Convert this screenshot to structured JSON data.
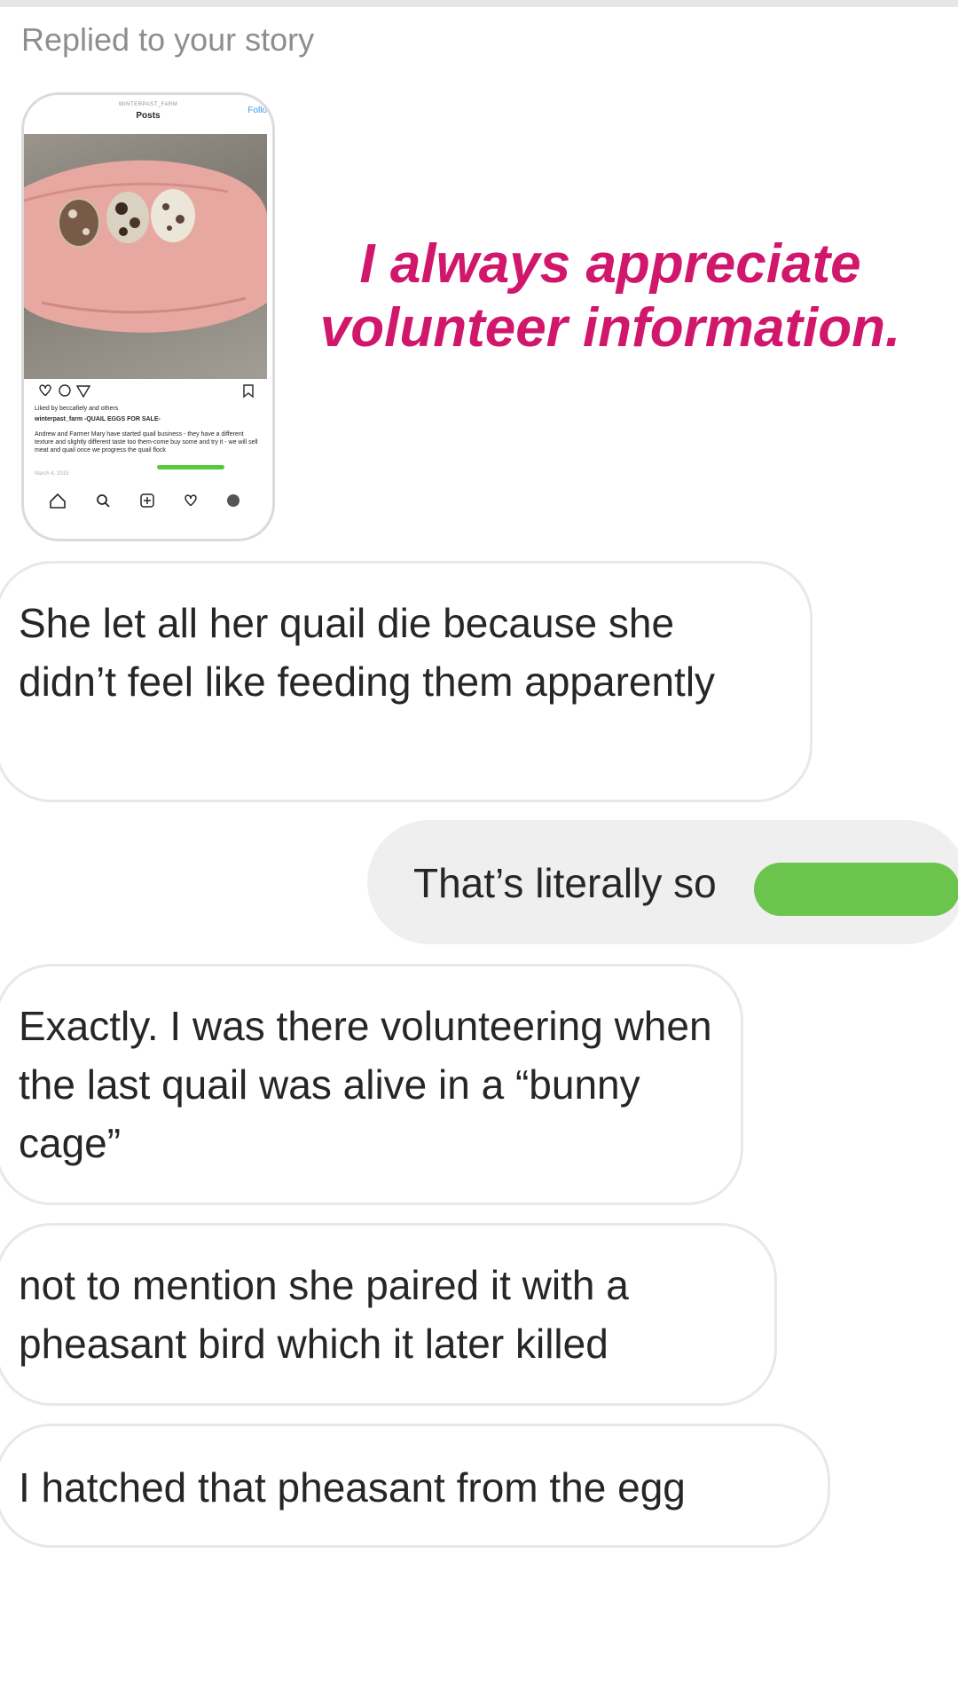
{
  "header": {
    "reply_label": "Replied to your story"
  },
  "story_preview": {
    "account": "WINTERPAST_FARM",
    "title": "Posts",
    "follow_label": "Follo",
    "liked_by": "Liked by beccafiely and others",
    "post_title": "winterpast_farm -QUAIL EGGS FOR SALE-",
    "caption": "Andrew and Farmer Mary have started quail business - they have a different texture and slightly different taste too them-come buy some and try it - we will sell meat and quail once we progress the quail flock",
    "date": "March 4, 2015",
    "icons": [
      "heart-icon",
      "comment-icon",
      "share-icon",
      "bookmark-icon"
    ],
    "bottom_nav_icons": [
      "home-icon",
      "search-icon",
      "add-icon",
      "heart-icon",
      "profile-icon"
    ],
    "highlight_color": "#58c93f"
  },
  "story_overlay_text": "I always appreciate volunteer information.",
  "messages": [
    {
      "direction": "incoming",
      "text": "She let all her quail die because she didn’t feel like feeding them apparently"
    },
    {
      "direction": "outgoing",
      "text": "That’s literally so"
    },
    {
      "direction": "incoming",
      "text": "Exactly. I was there volunteering when the last quail was alive in a “bunny cage”"
    },
    {
      "direction": "incoming",
      "text": "not to mention she paired it with a pheasant bird which it later killed"
    },
    {
      "direction": "incoming",
      "text": "I hatched that pheasant from the egg"
    }
  ],
  "colors": {
    "overlay_text": "#d0176b",
    "outgoing_bubble": "#efefef",
    "incoming_border": "#e8e8e8",
    "censor_bar": "#6bc54d"
  }
}
